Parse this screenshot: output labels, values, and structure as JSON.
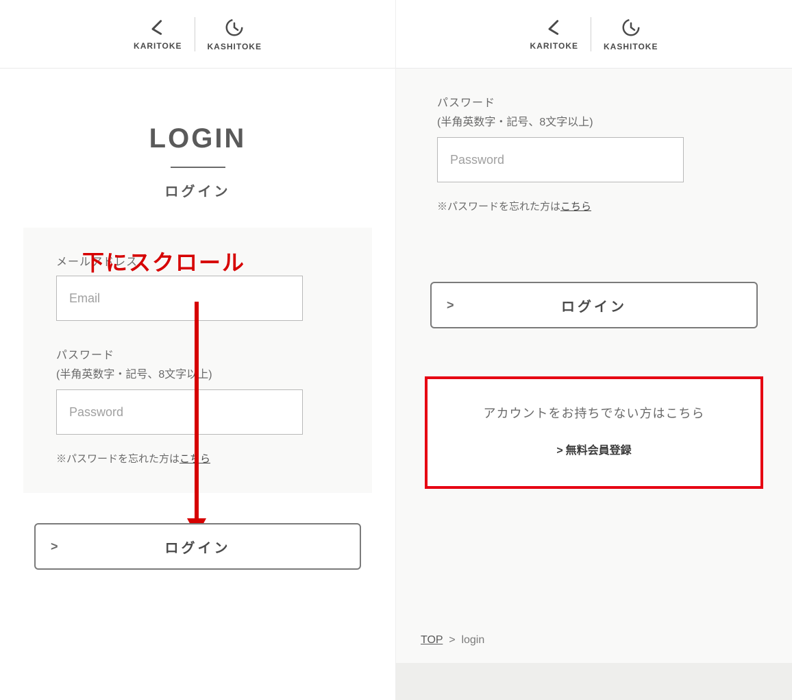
{
  "brand": {
    "left": "KARITOKE",
    "right": "KASHITOKE"
  },
  "title": {
    "en": "LOGIN",
    "jp": "ログイン"
  },
  "annotation": "下にスクロール",
  "form": {
    "email_label": "メールアドレス",
    "email_placeholder": "Email",
    "password_label": "パスワード",
    "password_hint": "(半角英数字・記号、8文字以上)",
    "password_placeholder": "Password",
    "forgot_prefix": "※パスワードを忘れた方は",
    "forgot_link": "こちら"
  },
  "login_button": {
    "chev": ">",
    "label": "ログイン"
  },
  "signup": {
    "text": "アカウントをお持ちでない方はこちら",
    "chev": ">",
    "link_label": "無料会員登録"
  },
  "breadcrumb": {
    "top": "TOP",
    "sep": ">",
    "current": "login"
  }
}
